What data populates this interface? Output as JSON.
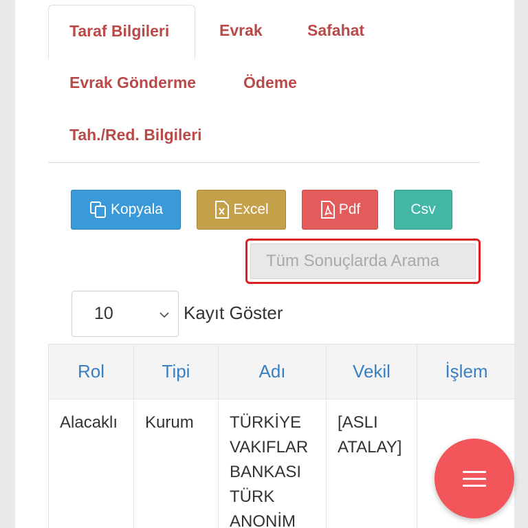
{
  "tabs": [
    {
      "label": "Taraf Bilgileri",
      "active": true
    },
    {
      "label": "Evrak",
      "active": false
    },
    {
      "label": "Safahat",
      "active": false
    },
    {
      "label": "Evrak Gönderme",
      "active": false
    },
    {
      "label": "Ödeme",
      "active": false
    },
    {
      "label": "Tah./Red. Bilgileri",
      "active": false
    }
  ],
  "export_buttons": {
    "copy": {
      "label": "Kopyala",
      "icon": "copy-icon",
      "color": "#3a9ad9"
    },
    "excel": {
      "label": "Excel",
      "icon": "excel-file-icon",
      "color": "#c5a04a"
    },
    "pdf": {
      "label": "Pdf",
      "icon": "pdf-file-icon",
      "color": "#e35b5b"
    },
    "csv": {
      "label": "Csv",
      "color": "#43b7a6"
    }
  },
  "search": {
    "placeholder": "Tüm Sonuçlarda Arama",
    "value": ""
  },
  "page_length": {
    "selected": "10",
    "label": "Kayıt Göster"
  },
  "table": {
    "columns": [
      "Rol",
      "Tipi",
      "Adı",
      "Vekil",
      "İşlem"
    ],
    "rows": [
      {
        "rol": "Alacaklı",
        "tipi": "Kurum",
        "adi": "TÜRKİYE VAKIFLAR BANKASI TÜRK ANONİM",
        "vekil": "[ASLI ATALAY]",
        "islem": ""
      }
    ]
  },
  "fab": {
    "icon": "menu-icon",
    "color": "#f2555a"
  }
}
